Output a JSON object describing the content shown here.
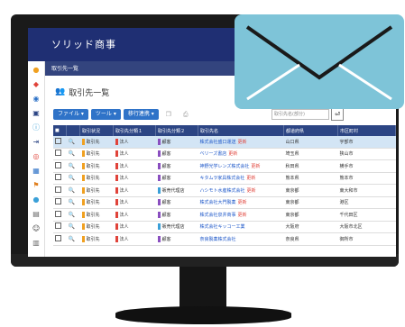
{
  "app": {
    "title": "ソリッド商事"
  },
  "breadcrumb": "取引先一覧",
  "page": {
    "title": "取引先一覧"
  },
  "toolbar": {
    "buttons": [
      "ファイル ▾",
      "ツール ▾",
      "移行連携 ▾"
    ],
    "search_placeholder": "取引先名(部分)"
  },
  "table": {
    "headers": [
      "",
      "",
      "取引状況",
      "取引先分類１",
      "取引先分類２",
      "取引先名",
      "都道府県",
      "市区町村"
    ],
    "rows": [
      {
        "status": "取引先",
        "class1": "法人",
        "class2": "顧客",
        "name": "株式会社盛口運送",
        "tag": "更新",
        "pref": "山口県",
        "city": "宇部市",
        "selected": true
      },
      {
        "status": "取引先",
        "class1": "法人",
        "class2": "顧客",
        "name": "ベリーズ書店",
        "tag": "更新",
        "pref": "埼玉県",
        "city": "狭山市",
        "selected": false
      },
      {
        "status": "取引先",
        "class1": "法人",
        "class2": "顧客",
        "name": "神野光学レンズ株式会社",
        "tag": "更新",
        "pref": "秋田県",
        "city": "横手市",
        "selected": false
      },
      {
        "status": "取引先",
        "class1": "法人",
        "class2": "顧客",
        "name": "キタムラ家具株式会社",
        "tag": "更新",
        "pref": "熊本県",
        "city": "熊本市",
        "selected": false
      },
      {
        "status": "取引先",
        "class1": "法人",
        "class2": "販売代理店",
        "name": "ハシモト水産株式会社",
        "tag": "更新",
        "pref": "東京都",
        "city": "東大和市",
        "selected": false
      },
      {
        "status": "取引先",
        "class1": "法人",
        "class2": "顧客",
        "name": "株式会社大門製薬",
        "tag": "更新",
        "pref": "東京都",
        "city": "港区",
        "selected": false
      },
      {
        "status": "取引先",
        "class1": "法人",
        "class2": "顧客",
        "name": "株式会社泉井商事",
        "tag": "更新",
        "pref": "東京都",
        "city": "千代田区",
        "selected": false
      },
      {
        "status": "取引先",
        "class1": "法人",
        "class2": "販売代理店",
        "name": "株式会社キッコー工業",
        "tag": "",
        "pref": "大阪府",
        "city": "大阪市北区",
        "selected": false
      },
      {
        "status": "取引先",
        "class1": "法人",
        "class2": "顧客",
        "name": "奈良製薬株式会社",
        "tag": "",
        "pref": "奈良県",
        "city": "御所市",
        "selected": false
      }
    ]
  },
  "colors": {
    "header": "#1f2f73",
    "accent": "#2f73c8",
    "status": "#f0a020",
    "class1": "#e0433a",
    "customer": "#8a4fc0",
    "agent": "#3aa0d8",
    "envelope": "#7ec4d8"
  }
}
